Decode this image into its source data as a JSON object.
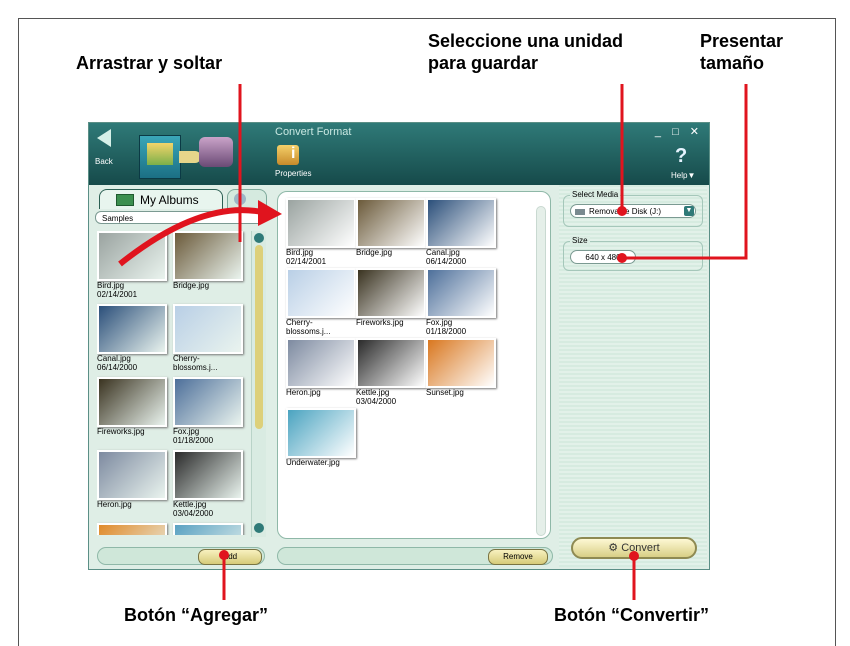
{
  "callouts": {
    "drag_drop": "Arrastrar y soltar",
    "select_drive": "Seleccione una unidad para guardar",
    "size_display": "Presentar tamaño",
    "add_button": "Botón “Agregar”",
    "convert_button": "Botón “Convertir”"
  },
  "window": {
    "title": "Convert Format",
    "controls": "_ □ ✕",
    "back_label": "Back",
    "properties_label": "Properties",
    "help_label": "Help▼"
  },
  "left_panel": {
    "tab_albums": "My Albums",
    "album_selected": "Samples",
    "add_label": "Add",
    "thumbs": [
      {
        "name": "Bird.jpg",
        "date": "02/14/2001",
        "color": "#9aa3a0"
      },
      {
        "name": "Bridge.jpg",
        "date": "",
        "color": "#6b5a3a"
      },
      {
        "name": "Canal.jpg",
        "date": "06/14/2000",
        "color": "#2b4f7a"
      },
      {
        "name": "Cherry-blossoms.j...",
        "date": "",
        "color": "#b9cfe6"
      },
      {
        "name": "Fireworks.jpg",
        "date": "",
        "color": "#3a3320"
      },
      {
        "name": "Fox.jpg",
        "date": "01/18/2000",
        "color": "#4d6f9a"
      },
      {
        "name": "Heron.jpg",
        "date": "",
        "color": "#7d8aa0"
      },
      {
        "name": "Kettle.jpg",
        "date": "03/04/2000",
        "color": "#2a2a2a"
      },
      {
        "name": "",
        "date": "",
        "color": "#e08a2a"
      },
      {
        "name": "",
        "date": "",
        "color": "#5aa1c2"
      }
    ]
  },
  "center_panel": {
    "remove_label": "Remove",
    "thumbs": [
      {
        "name": "Bird.jpg",
        "date": "02/14/2001",
        "color": "#9aa3a0"
      },
      {
        "name": "Bridge.jpg",
        "date": "",
        "color": "#6b5a3a"
      },
      {
        "name": "Canal.jpg",
        "date": "06/14/2000",
        "color": "#2b4f7a"
      },
      {
        "name": "Cherry-blossoms.j...",
        "date": "",
        "color": "#b9cfe6"
      },
      {
        "name": "Fireworks.jpg",
        "date": "",
        "color": "#3a3320"
      },
      {
        "name": "Fox.jpg",
        "date": "01/18/2000",
        "color": "#4d6f9a"
      },
      {
        "name": "Heron.jpg",
        "date": "",
        "color": "#7d8aa0"
      },
      {
        "name": "Kettle.jpg",
        "date": "03/04/2000",
        "color": "#2a2a2a"
      },
      {
        "name": "Sunset.jpg",
        "date": "",
        "color": "#d9771f"
      },
      {
        "name": "Underwater.jpg",
        "date": "",
        "color": "#4aa3c0"
      }
    ]
  },
  "right_panel": {
    "select_media_label": "Select Media",
    "media_value": "Removable Disk (J:)",
    "size_label": "Size",
    "size_value": "640 x 480",
    "convert_label": "Convert"
  },
  "colors": {
    "accent_red": "#e0141e",
    "titlebar": "#164a4a",
    "panel_bg": "#dfeee6"
  }
}
